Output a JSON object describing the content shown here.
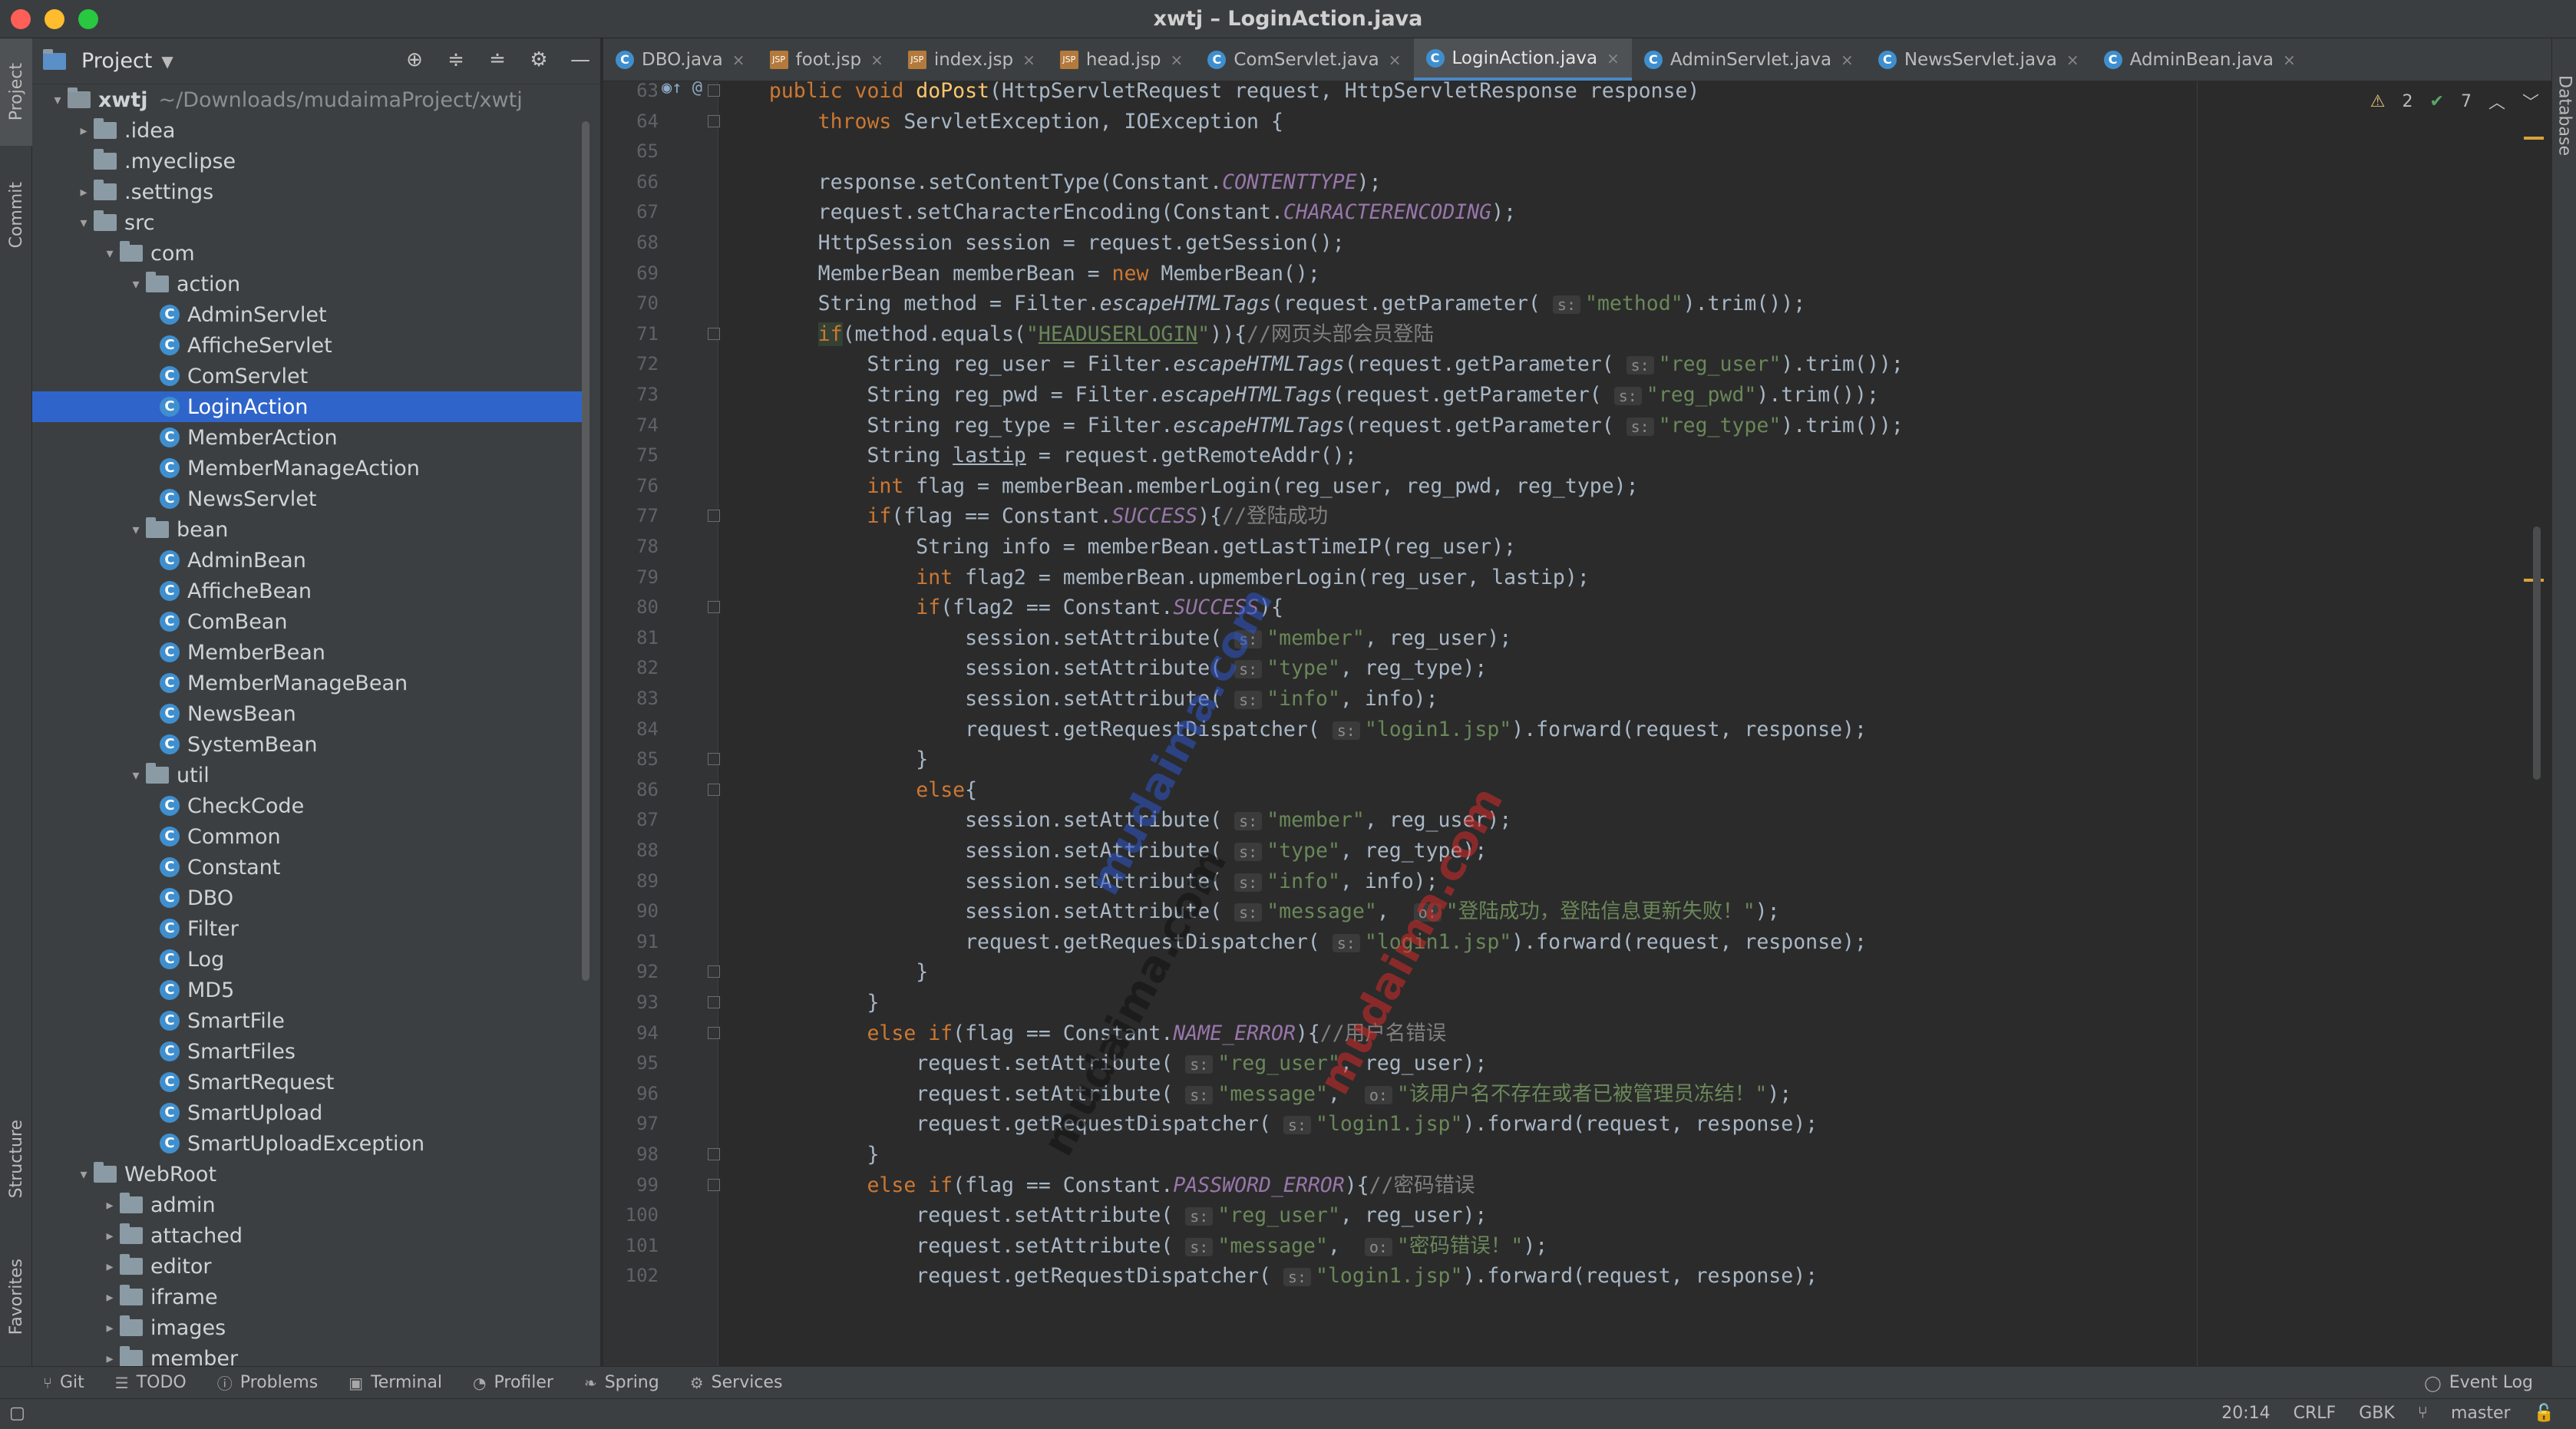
{
  "window": {
    "title": "xwtj – LoginAction.java",
    "traffic_lights": [
      "#ff5f57",
      "#febc2e",
      "#28c840"
    ]
  },
  "left_strip": {
    "project": "Project",
    "commit": "Commit",
    "structure": "Structure",
    "favorites": "Favorites"
  },
  "right_strip": {
    "database": "Database"
  },
  "project_panel": {
    "title": "Project",
    "header_icons": [
      "target-icon",
      "expand-all-icon",
      "collapse-all-icon",
      "gear-icon",
      "minimize-icon"
    ]
  },
  "tree": [
    {
      "label": "xwtj",
      "path": "~/Downloads/mudaimaProject/xwtj",
      "type": "module",
      "arrow": "▾",
      "depth": 0
    },
    {
      "label": ".idea",
      "type": "folder",
      "arrow": "▸",
      "depth": 1
    },
    {
      "label": ".myeclipse",
      "type": "folder",
      "arrow": "",
      "depth": 1
    },
    {
      "label": ".settings",
      "type": "folder",
      "arrow": "▸",
      "depth": 1
    },
    {
      "label": "src",
      "type": "folder",
      "arrow": "▾",
      "depth": 1
    },
    {
      "label": "com",
      "type": "folder",
      "arrow": "▾",
      "depth": 2
    },
    {
      "label": "action",
      "type": "folder",
      "arrow": "▾",
      "depth": 3
    },
    {
      "label": "AdminServlet",
      "type": "class",
      "depth": 4
    },
    {
      "label": "AfficheServlet",
      "type": "class",
      "depth": 4
    },
    {
      "label": "ComServlet",
      "type": "class",
      "depth": 4
    },
    {
      "label": "LoginAction",
      "type": "class",
      "depth": 4,
      "selected": true
    },
    {
      "label": "MemberAction",
      "type": "class",
      "depth": 4
    },
    {
      "label": "MemberManageAction",
      "type": "class",
      "depth": 4
    },
    {
      "label": "NewsServlet",
      "type": "class",
      "depth": 4
    },
    {
      "label": "bean",
      "type": "folder",
      "arrow": "▾",
      "depth": 3
    },
    {
      "label": "AdminBean",
      "type": "class",
      "depth": 4
    },
    {
      "label": "AfficheBean",
      "type": "class",
      "depth": 4
    },
    {
      "label": "ComBean",
      "type": "class",
      "depth": 4
    },
    {
      "label": "MemberBean",
      "type": "class",
      "depth": 4
    },
    {
      "label": "MemberManageBean",
      "type": "class",
      "depth": 4
    },
    {
      "label": "NewsBean",
      "type": "class",
      "depth": 4
    },
    {
      "label": "SystemBean",
      "type": "class",
      "depth": 4
    },
    {
      "label": "util",
      "type": "folder",
      "arrow": "▾",
      "depth": 3
    },
    {
      "label": "CheckCode",
      "type": "class",
      "depth": 4
    },
    {
      "label": "Common",
      "type": "class",
      "depth": 4
    },
    {
      "label": "Constant",
      "type": "class",
      "depth": 4
    },
    {
      "label": "DBO",
      "type": "class",
      "depth": 4
    },
    {
      "label": "Filter",
      "type": "class",
      "depth": 4
    },
    {
      "label": "Log",
      "type": "class",
      "depth": 4
    },
    {
      "label": "MD5",
      "type": "class",
      "depth": 4
    },
    {
      "label": "SmartFile",
      "type": "class",
      "depth": 4
    },
    {
      "label": "SmartFiles",
      "type": "class",
      "depth": 4
    },
    {
      "label": "SmartRequest",
      "type": "class",
      "depth": 4
    },
    {
      "label": "SmartUpload",
      "type": "class",
      "depth": 4
    },
    {
      "label": "SmartUploadException",
      "type": "class",
      "depth": 4
    },
    {
      "label": "WebRoot",
      "type": "folder",
      "arrow": "▾",
      "depth": 1
    },
    {
      "label": "admin",
      "type": "folder",
      "arrow": "▸",
      "depth": 2
    },
    {
      "label": "attached",
      "type": "folder",
      "arrow": "▸",
      "depth": 2
    },
    {
      "label": "editor",
      "type": "folder",
      "arrow": "▸",
      "depth": 2
    },
    {
      "label": "iframe",
      "type": "folder",
      "arrow": "▸",
      "depth": 2
    },
    {
      "label": "images",
      "type": "folder",
      "arrow": "▸",
      "depth": 2
    },
    {
      "label": "member",
      "type": "folder",
      "arrow": "▸",
      "depth": 2
    }
  ],
  "tabs": [
    {
      "label": "DBO.java",
      "icon": "c"
    },
    {
      "label": "foot.jsp",
      "icon": "jsp"
    },
    {
      "label": "index.jsp",
      "icon": "jsp"
    },
    {
      "label": "head.jsp",
      "icon": "jsp"
    },
    {
      "label": "ComServlet.java",
      "icon": "c"
    },
    {
      "label": "LoginAction.java",
      "icon": "c",
      "active": true
    },
    {
      "label": "AdminServlet.java",
      "icon": "c"
    },
    {
      "label": "NewsServlet.java",
      "icon": "c"
    },
    {
      "label": "AdminBean.java",
      "icon": "c"
    }
  ],
  "inspections": {
    "warnings": "2",
    "checks": "7"
  },
  "gutter_marks": {
    "63": "◉↑ @"
  },
  "code_lines": [
    {
      "n": "63",
      "fold": true,
      "t": [
        [
          "    ",
          ""
        ],
        [
          "public void ",
          "kw"
        ],
        [
          "doPost",
          "fn"
        ],
        [
          "(HttpServletRequest request, HttpServletResponse response)",
          ""
        ]
      ]
    },
    {
      "n": "64",
      "fold": true,
      "t": [
        [
          "        ",
          ""
        ],
        [
          "throws ",
          "kw"
        ],
        [
          "ServletException, IOException {",
          ""
        ]
      ]
    },
    {
      "n": "65",
      "t": []
    },
    {
      "n": "66",
      "t": [
        [
          "        response.setContentType(Constant.",
          ""
        ],
        [
          "CONTENTTYPE",
          "cn"
        ],
        [
          ");",
          ""
        ]
      ]
    },
    {
      "n": "67",
      "t": [
        [
          "        request.setCharacterEncoding(Constant.",
          ""
        ],
        [
          "CHARACTERENCODING",
          "cn"
        ],
        [
          ");",
          ""
        ]
      ]
    },
    {
      "n": "68",
      "t": [
        [
          "        HttpSession session = request.getSession();",
          ""
        ]
      ]
    },
    {
      "n": "69",
      "t": [
        [
          "        MemberBean memberBean = ",
          ""
        ],
        [
          "new ",
          "kw"
        ],
        [
          "MemberBean();",
          ""
        ]
      ]
    },
    {
      "n": "70",
      "t": [
        [
          "        String method = Filter.",
          ""
        ],
        [
          "escapeHTMLTags",
          "mi"
        ],
        [
          "(request.getParameter( ",
          ""
        ],
        [
          "s:",
          "hint"
        ],
        [
          "\"method\"",
          "str"
        ],
        [
          ").trim());",
          ""
        ]
      ]
    },
    {
      "n": "71",
      "fold": true,
      "t": [
        [
          "        ",
          ""
        ],
        [
          "if",
          "kw hlbox"
        ],
        [
          "(method.equals(",
          ""
        ],
        [
          "\"",
          "str"
        ],
        [
          "HEADUSERLOGIN",
          "str un"
        ],
        [
          "\"",
          "str"
        ],
        [
          ")){",
          ""
        ],
        [
          "//网页头部会员登陆",
          "cm"
        ]
      ]
    },
    {
      "n": "72",
      "t": [
        [
          "            String reg_user = Filter.",
          ""
        ],
        [
          "escapeHTMLTags",
          "mi"
        ],
        [
          "(request.getParameter( ",
          ""
        ],
        [
          "s:",
          "hint"
        ],
        [
          "\"reg_user\"",
          "str"
        ],
        [
          ").trim());",
          ""
        ]
      ]
    },
    {
      "n": "73",
      "t": [
        [
          "            String reg_pwd = Filter.",
          ""
        ],
        [
          "escapeHTMLTags",
          "mi"
        ],
        [
          "(request.getParameter( ",
          ""
        ],
        [
          "s:",
          "hint"
        ],
        [
          "\"reg_pwd\"",
          "str"
        ],
        [
          ").trim());",
          ""
        ]
      ]
    },
    {
      "n": "74",
      "t": [
        [
          "            String reg_type = Filter.",
          ""
        ],
        [
          "escapeHTMLTags",
          "mi"
        ],
        [
          "(request.getParameter( ",
          ""
        ],
        [
          "s:",
          "hint"
        ],
        [
          "\"reg_type\"",
          "str"
        ],
        [
          ").trim());",
          ""
        ]
      ]
    },
    {
      "n": "75",
      "t": [
        [
          "            String ",
          ""
        ],
        [
          "lastip",
          "un"
        ],
        [
          " = request.getRemoteAddr();",
          ""
        ]
      ]
    },
    {
      "n": "76",
      "t": [
        [
          "            ",
          ""
        ],
        [
          "int ",
          "kw"
        ],
        [
          "flag = memberBean.memberLogin(reg_user, reg_pwd, reg_type);",
          ""
        ]
      ]
    },
    {
      "n": "77",
      "fold": true,
      "t": [
        [
          "            ",
          ""
        ],
        [
          "if",
          "kw"
        ],
        [
          "(flag == Constant.",
          ""
        ],
        [
          "SUCCESS",
          "cn"
        ],
        [
          "){",
          ""
        ],
        [
          "//登陆成功",
          "cm"
        ]
      ]
    },
    {
      "n": "78",
      "t": [
        [
          "                String info = memberBean.getLastTimeIP(reg_user);",
          ""
        ]
      ]
    },
    {
      "n": "79",
      "t": [
        [
          "                ",
          ""
        ],
        [
          "int ",
          "kw"
        ],
        [
          "flag2 = memberBean.upmemberLogin(reg_user, lastip);",
          ""
        ]
      ]
    },
    {
      "n": "80",
      "fold": true,
      "t": [
        [
          "                ",
          ""
        ],
        [
          "if",
          "kw"
        ],
        [
          "(flag2 == Constant.",
          ""
        ],
        [
          "SUCCESS",
          "cn"
        ],
        [
          "){",
          ""
        ]
      ]
    },
    {
      "n": "81",
      "t": [
        [
          "                    session.setAttribute( ",
          ""
        ],
        [
          "s:",
          "hint"
        ],
        [
          "\"member\"",
          "str"
        ],
        [
          ", reg_user);",
          ""
        ]
      ]
    },
    {
      "n": "82",
      "t": [
        [
          "                    session.setAttribute( ",
          ""
        ],
        [
          "s:",
          "hint"
        ],
        [
          "\"type\"",
          "str"
        ],
        [
          ", reg_type);",
          ""
        ]
      ]
    },
    {
      "n": "83",
      "t": [
        [
          "                    session.setAttribute( ",
          ""
        ],
        [
          "s:",
          "hint"
        ],
        [
          "\"info\"",
          "str"
        ],
        [
          ", info);",
          ""
        ]
      ]
    },
    {
      "n": "84",
      "t": [
        [
          "                    request.getRequestDispatcher( ",
          ""
        ],
        [
          "s:",
          "hint"
        ],
        [
          "\"login1.jsp\"",
          "str"
        ],
        [
          ").forward(request, response);",
          ""
        ]
      ]
    },
    {
      "n": "85",
      "fold": true,
      "t": [
        [
          "                }",
          ""
        ]
      ]
    },
    {
      "n": "86",
      "fold": true,
      "t": [
        [
          "                ",
          ""
        ],
        [
          "else",
          "kw"
        ],
        [
          "{",
          ""
        ]
      ]
    },
    {
      "n": "87",
      "t": [
        [
          "                    session.setAttribute( ",
          ""
        ],
        [
          "s:",
          "hint"
        ],
        [
          "\"member\"",
          "str"
        ],
        [
          ", reg_user);",
          ""
        ]
      ]
    },
    {
      "n": "88",
      "t": [
        [
          "                    session.setAttribute( ",
          ""
        ],
        [
          "s:",
          "hint"
        ],
        [
          "\"type\"",
          "str"
        ],
        [
          ", reg_type);",
          ""
        ]
      ]
    },
    {
      "n": "89",
      "t": [
        [
          "                    session.setAttribute( ",
          ""
        ],
        [
          "s:",
          "hint"
        ],
        [
          "\"info\"",
          "str"
        ],
        [
          ", info);",
          ""
        ]
      ]
    },
    {
      "n": "90",
      "t": [
        [
          "                    session.setAttribute( ",
          ""
        ],
        [
          "s:",
          "hint"
        ],
        [
          "\"message\"",
          "str"
        ],
        [
          ",  ",
          ""
        ],
        [
          "o:",
          "hint"
        ],
        [
          "\"登陆成功，登陆信息更新失败！\"",
          "str"
        ],
        [
          ");",
          ""
        ]
      ]
    },
    {
      "n": "91",
      "t": [
        [
          "                    request.getRequestDispatcher( ",
          ""
        ],
        [
          "s:",
          "hint"
        ],
        [
          "\"login1.jsp\"",
          "str"
        ],
        [
          ").forward(request, response);",
          ""
        ]
      ]
    },
    {
      "n": "92",
      "fold": true,
      "t": [
        [
          "                }",
          ""
        ]
      ]
    },
    {
      "n": "93",
      "fold": true,
      "t": [
        [
          "            }",
          ""
        ]
      ]
    },
    {
      "n": "94",
      "fold": true,
      "t": [
        [
          "            ",
          ""
        ],
        [
          "else if",
          "kw"
        ],
        [
          "(flag == Constant.",
          ""
        ],
        [
          "NAME_ERROR",
          "cn"
        ],
        [
          "){",
          ""
        ],
        [
          "//用户名错误",
          "cm"
        ]
      ]
    },
    {
      "n": "95",
      "t": [
        [
          "                request.setAttribute( ",
          ""
        ],
        [
          "s:",
          "hint"
        ],
        [
          "\"reg_user\"",
          "str"
        ],
        [
          ", reg_user);",
          ""
        ]
      ]
    },
    {
      "n": "96",
      "t": [
        [
          "                request.setAttribute( ",
          ""
        ],
        [
          "s:",
          "hint"
        ],
        [
          "\"message\"",
          "str"
        ],
        [
          ",  ",
          ""
        ],
        [
          "o:",
          "hint"
        ],
        [
          "\"该用户名不存在或者已被管理员冻结！\"",
          "str"
        ],
        [
          ");",
          ""
        ]
      ]
    },
    {
      "n": "97",
      "t": [
        [
          "                request.getRequestDispatcher( ",
          ""
        ],
        [
          "s:",
          "hint"
        ],
        [
          "\"login1.jsp\"",
          "str"
        ],
        [
          ").forward(request, response);",
          ""
        ]
      ]
    },
    {
      "n": "98",
      "fold": true,
      "t": [
        [
          "            }",
          ""
        ]
      ]
    },
    {
      "n": "99",
      "fold": true,
      "t": [
        [
          "            ",
          ""
        ],
        [
          "else if",
          "kw"
        ],
        [
          "(flag == Constant.",
          ""
        ],
        [
          "PASSWORD_ERROR",
          "cn"
        ],
        [
          "){",
          ""
        ],
        [
          "//密码错误",
          "cm"
        ]
      ]
    },
    {
      "n": "100",
      "t": [
        [
          "                request.setAttribute( ",
          ""
        ],
        [
          "s:",
          "hint"
        ],
        [
          "\"reg_user\"",
          "str"
        ],
        [
          ", reg_user);",
          ""
        ]
      ]
    },
    {
      "n": "101",
      "t": [
        [
          "                request.setAttribute( ",
          ""
        ],
        [
          "s:",
          "hint"
        ],
        [
          "\"message\"",
          "str"
        ],
        [
          ",  ",
          ""
        ],
        [
          "o:",
          "hint"
        ],
        [
          "\"密码错误！\"",
          "str"
        ],
        [
          ");",
          ""
        ]
      ]
    },
    {
      "n": "102",
      "t": [
        [
          "                request.getRequestDispatcher( ",
          ""
        ],
        [
          "s:",
          "hint"
        ],
        [
          "\"login1.jsp\"",
          "str"
        ],
        [
          ").forward(request, response);",
          ""
        ]
      ]
    }
  ],
  "watermarks": [
    {
      "text": "mudaima.com",
      "color": "#2e56c9"
    },
    {
      "text": "mudaima.com",
      "color": "#111111"
    },
    {
      "text": "mudaima.com",
      "color": "#d42a2a"
    }
  ],
  "bottom_tools": [
    {
      "label": "Git",
      "icon": "git-icon",
      "glyph": "⑂"
    },
    {
      "label": "TODO",
      "icon": "todo-icon",
      "glyph": "☰"
    },
    {
      "label": "Problems",
      "icon": "problems-icon",
      "glyph": "ⓘ"
    },
    {
      "label": "Terminal",
      "icon": "terminal-icon",
      "glyph": "▣"
    },
    {
      "label": "Profiler",
      "icon": "profiler-icon",
      "glyph": "◔"
    },
    {
      "label": "Spring",
      "icon": "spring-icon",
      "glyph": "❧"
    },
    {
      "label": "Services",
      "icon": "services-icon",
      "glyph": "⚙"
    }
  ],
  "event_log": "Event Log",
  "status": {
    "position": "20:14",
    "line_sep": "CRLF",
    "encoding": "GBK",
    "branch": "master"
  }
}
